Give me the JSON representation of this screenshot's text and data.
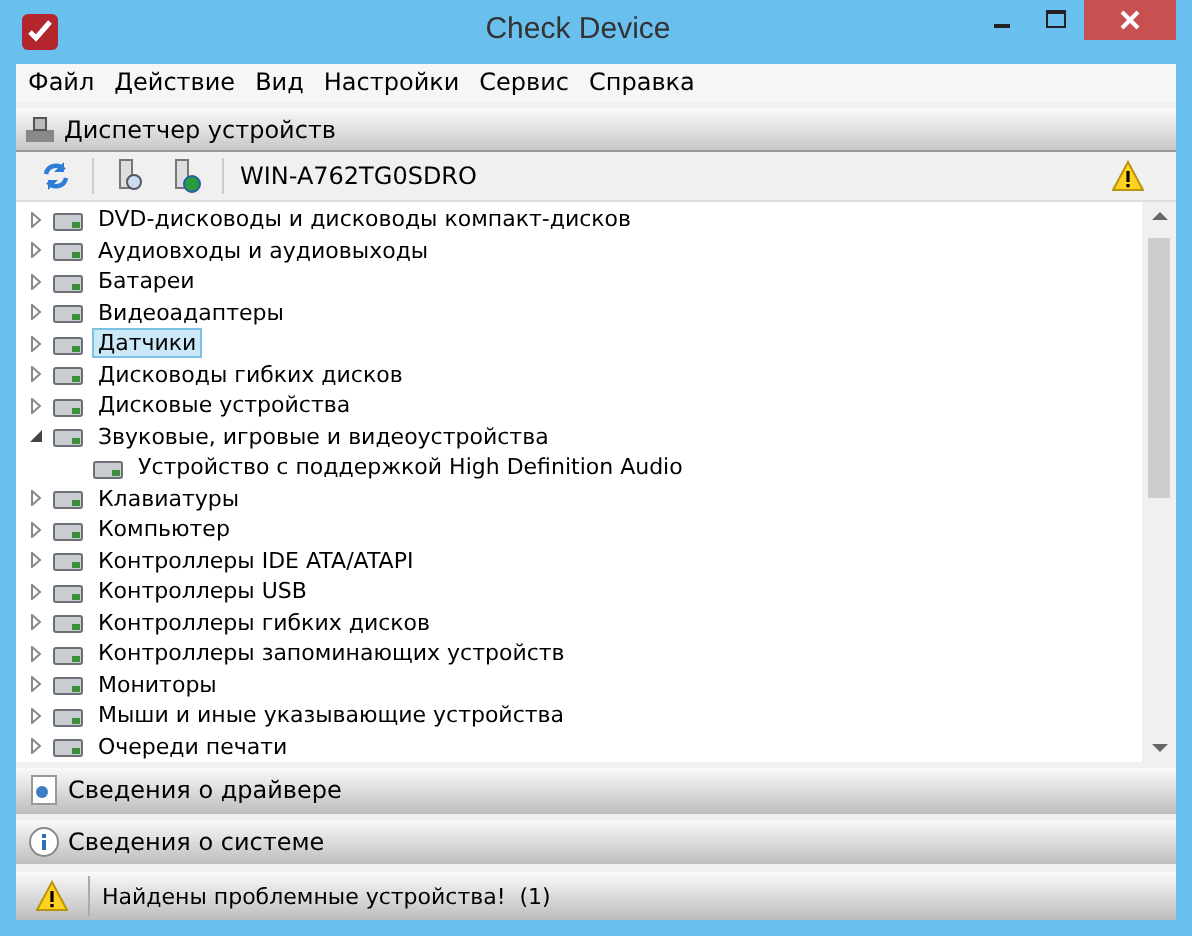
{
  "window": {
    "title": "Check Device"
  },
  "menu": [
    "Файл",
    "Действие",
    "Вид",
    "Настройки",
    "Сервис",
    "Справка"
  ],
  "header": {
    "title": "Диспетчер устройств"
  },
  "toolbar": {
    "computer": "WIN-A762TG0SDRO"
  },
  "tree": [
    {
      "label": "DVD-дисководы и дисководы компакт-дисков",
      "expanded": false,
      "selected": false
    },
    {
      "label": "Аудиовходы и аудиовыходы",
      "expanded": false,
      "selected": false
    },
    {
      "label": "Батареи",
      "expanded": false,
      "selected": false
    },
    {
      "label": "Видеоадаптеры",
      "expanded": false,
      "selected": false
    },
    {
      "label": "Датчики",
      "expanded": false,
      "selected": true
    },
    {
      "label": "Дисководы гибких дисков",
      "expanded": false,
      "selected": false
    },
    {
      "label": "Дисковые устройства",
      "expanded": false,
      "selected": false
    },
    {
      "label": "Звуковые, игровые и видеоустройства",
      "expanded": true,
      "selected": false,
      "children": [
        {
          "label": "Устройство с поддержкой High Definition Audio",
          "selected": false
        }
      ]
    },
    {
      "label": "Клавиатуры",
      "expanded": false,
      "selected": false
    },
    {
      "label": "Компьютер",
      "expanded": false,
      "selected": false
    },
    {
      "label": "Контроллеры IDE ATA/ATAPI",
      "expanded": false,
      "selected": false
    },
    {
      "label": "Контроллеры USB",
      "expanded": false,
      "selected": false
    },
    {
      "label": "Контроллеры гибких дисков",
      "expanded": false,
      "selected": false
    },
    {
      "label": "Контроллеры запоминающих устройств",
      "expanded": false,
      "selected": false
    },
    {
      "label": "Мониторы",
      "expanded": false,
      "selected": false
    },
    {
      "label": "Мыши и иные указывающие устройства",
      "expanded": false,
      "selected": false
    },
    {
      "label": "Очереди печати",
      "expanded": false,
      "selected": false
    }
  ],
  "panels": [
    {
      "kind": "driver",
      "label": "Сведения о драйвере"
    },
    {
      "kind": "system",
      "label": "Сведения о системе"
    }
  ],
  "status_bar": {
    "message": "Найдены проблемные устройства!  (1)"
  }
}
